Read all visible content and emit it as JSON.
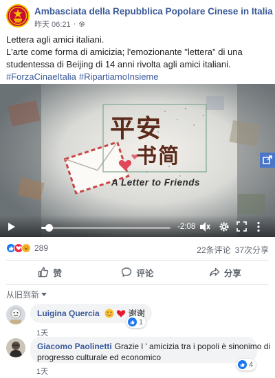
{
  "post": {
    "page_name": "Ambasciata della Repubblica Popolare Cinese in Italia",
    "time": "昨天 06:21",
    "privacy_icon": "settings-gear-icon",
    "lines": [
      "Lettera agli amici italiani.",
      "L'arte come forma di amicizia; l'emozionante \"lettera\" di una",
      "studentessa di Beijing di 14 anni rivolta agli amici italiani."
    ],
    "hashtags": [
      "#ForzaCinaeItalia",
      "#RipartiamoInsieme"
    ]
  },
  "video": {
    "title_line1": "平安",
    "title_line2": "书简",
    "subtitle": "A Letter to Friends",
    "time_remaining": "-2:08",
    "progress": 0.06
  },
  "stats": {
    "reaction_count": "289",
    "comments": "22条评论",
    "shares": "37次分享"
  },
  "actions": {
    "like": "赞",
    "comment": "评论",
    "share": "分享"
  },
  "comments": {
    "sort_label": "从旧到新",
    "items": [
      {
        "author": "Luigina Quercia",
        "text": "谢谢",
        "likes": "1",
        "time": "1天"
      },
      {
        "author": "Giacomo Paolinetti",
        "text_line1": "Grazie l ' amicizia tra i popoli è sinonimo di",
        "text_line2": "progresso culturale ed economico",
        "likes": "4",
        "time": "1天"
      }
    ]
  },
  "colors": {
    "link_blue": "#385898",
    "like_blue": "#1877f2",
    "emblem_red": "#c8102e",
    "emblem_gold": "#f2c200"
  }
}
